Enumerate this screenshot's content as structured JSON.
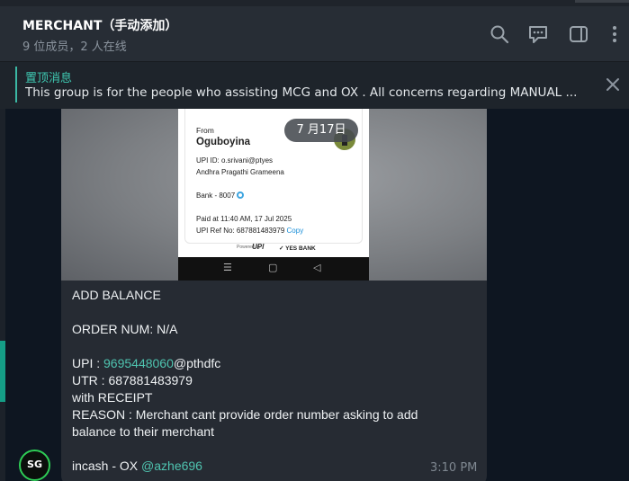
{
  "header": {
    "title": "MERCHANT（手动添加）",
    "subtitle": "9 位成员，2 人在线",
    "icons": [
      "search-icon",
      "comment-icon",
      "sidebar-toggle-icon",
      "more-icon"
    ]
  },
  "pinned": {
    "title": "置顶消息",
    "text": "This group is for the people who assisting MCG and OX . All concerns regarding MANUAL ..."
  },
  "message": {
    "date_badge": "7 月17日",
    "receipt": {
      "from_label": "From",
      "name": "Oguboyina",
      "upi_id": "UPI ID: o.srivani@ptyes",
      "bank_name": "Andhra Pragathi Grameena",
      "bank_number": "Bank - 8007",
      "paid_at": "Paid at 11:40 AM, 17 Jul 2025",
      "ref": "UPI Ref No: 687881483979",
      "copy": "Copy",
      "powered_by": "Powered by",
      "upi_logo": "UPI",
      "yes_bank": "YES BANK"
    },
    "lines": {
      "l1": "ADD BALANCE",
      "l2": "ORDER NUM: N/A",
      "upi_prefix": "UPI : ",
      "upi_number": "9695448060",
      "upi_suffix": "@pthdfc",
      "l4": "UTR : 687881483979",
      "l5": "with RECEIPT",
      "l6": "REASON : Merchant cant provide order number asking to add",
      "l7": "balance to their merchant",
      "sender_prefix": "incash - OX ",
      "sender_handle": "@azhe696"
    },
    "time": "3:10 PM"
  },
  "avatar": {
    "initials": "SG"
  },
  "colors": {
    "accent": "#3fc9b2",
    "header_bg": "#272d35",
    "bubble_bg": "#262b33"
  }
}
